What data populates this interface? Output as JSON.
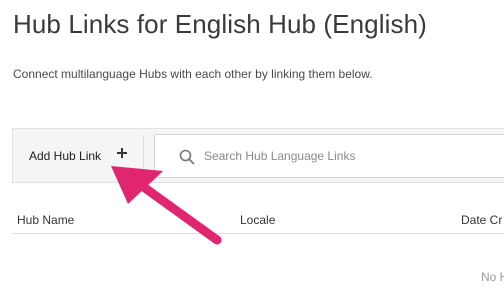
{
  "page": {
    "title": "Hub Links for English Hub (English)",
    "description": "Connect multilanguage Hubs with each other by linking them below."
  },
  "toolbar": {
    "add_label": "Add Hub Link",
    "search": {
      "placeholder": "Search Hub Language Links",
      "value": ""
    }
  },
  "table": {
    "columns": [
      "Hub Name",
      "Locale",
      "Date Cr"
    ],
    "empty_text": "No H"
  },
  "icons": {
    "add": "plus-icon",
    "search": "search-icon",
    "annotation": "arrow-icon"
  },
  "colors": {
    "annotation_arrow": "#e0266f",
    "toolbar_bg": "#f5f5f5"
  }
}
